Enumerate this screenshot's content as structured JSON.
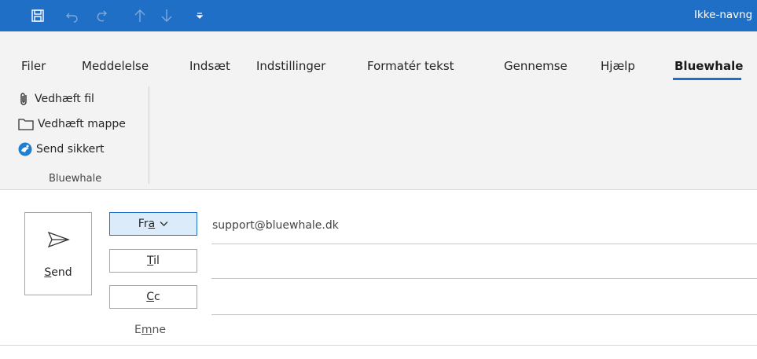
{
  "titlebar": {
    "title": "Ikke-navng",
    "icons": [
      "save-icon",
      "undo-icon",
      "redo-icon",
      "arrow-up-icon",
      "arrow-down-icon",
      "customize-icon"
    ],
    "bg_color": "#1f6fc6"
  },
  "menu": {
    "tabs": [
      {
        "label": "Filer"
      },
      {
        "label": "Meddelelse"
      },
      {
        "label": "Indsæt"
      },
      {
        "label": "Indstillinger"
      },
      {
        "label": "Formatér tekst"
      },
      {
        "label": "Gennemse"
      },
      {
        "label": "Hjælp"
      },
      {
        "label": "Bluewhale",
        "active": true
      }
    ]
  },
  "ribbon": {
    "items": [
      {
        "label": "Vedhæft fil",
        "icon": "paperclip-icon"
      },
      {
        "label": "Vedhæft mappe",
        "icon": "folder-icon"
      },
      {
        "label": "Send sikkert",
        "icon": "bluewhale-icon"
      }
    ],
    "group_label": "Bluewhale"
  },
  "compose": {
    "send": {
      "pre": "",
      "accel": "S",
      "post": "end"
    },
    "from_button": {
      "pre": "Fr",
      "accel": "a",
      "post": ""
    },
    "to_button": {
      "pre": "",
      "accel": "T",
      "post": "il"
    },
    "cc_button": {
      "pre": "",
      "accel": "C",
      "post": "c"
    },
    "subject_label": {
      "pre": "E",
      "accel": "m",
      "post": "ne"
    },
    "from_value": "support@bluewhale.dk",
    "to_value": "",
    "cc_value": "",
    "subject_value": ""
  },
  "colors": {
    "accent": "#1f6fc6",
    "ribbon_bg": "#f3f3f3"
  }
}
